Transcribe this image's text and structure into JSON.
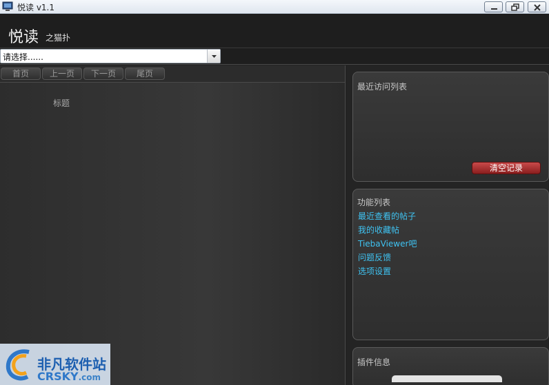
{
  "window": {
    "title": "悦读 v1.1",
    "icon": "monitor-app-icon"
  },
  "header": {
    "brand": "悦读",
    "brand_sub": "之猫扑"
  },
  "selector": {
    "value": "请选择......",
    "icon": "chevron-down-icon"
  },
  "pager": {
    "first": "首页",
    "prev": "上一页",
    "next": "下一页",
    "last": "尾页"
  },
  "list": {
    "column_title": "标题"
  },
  "recent": {
    "title": "最近访问列表",
    "clear_label": "清空记录"
  },
  "functions": {
    "title": "功能列表",
    "items": [
      "最近查看的帖子",
      "我的收藏帖",
      "TiebaViewer吧",
      "问题反馈",
      "选项设置"
    ]
  },
  "plugins": {
    "title": "插件信息"
  },
  "watermark": {
    "line1": "非凡软件站",
    "line2": "CRSKY",
    "line2_suffix": ".com"
  },
  "colors": {
    "link": "#3fc3f2",
    "clear_button": "#a83232",
    "background": "#222222"
  }
}
